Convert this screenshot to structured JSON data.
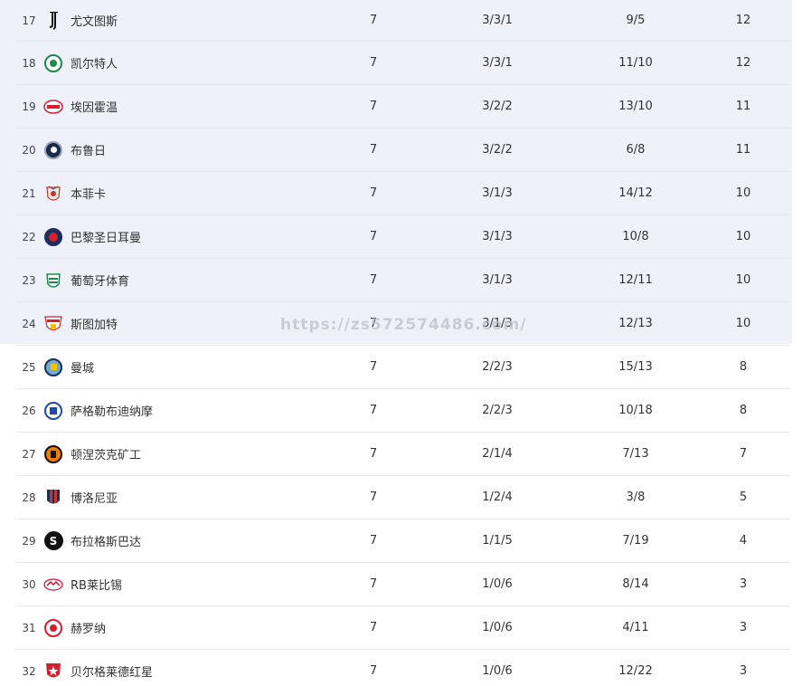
{
  "rows": [
    {
      "rank": "17",
      "team": "尤文图斯",
      "logo": "juventus-logo-icon",
      "played": "7",
      "wdl": "3/3/1",
      "goals": "9/5",
      "points": "12"
    },
    {
      "rank": "18",
      "team": "凯尔特人",
      "logo": "celtic-logo-icon",
      "played": "7",
      "wdl": "3/3/1",
      "goals": "11/10",
      "points": "12"
    },
    {
      "rank": "19",
      "team": "埃因霍温",
      "logo": "psv-logo-icon",
      "played": "7",
      "wdl": "3/2/2",
      "goals": "13/10",
      "points": "11"
    },
    {
      "rank": "20",
      "team": "布鲁日",
      "logo": "club-brugge-logo-icon",
      "played": "7",
      "wdl": "3/2/2",
      "goals": "6/8",
      "points": "11"
    },
    {
      "rank": "21",
      "team": "本菲卡",
      "logo": "benfica-logo-icon",
      "played": "7",
      "wdl": "3/1/3",
      "goals": "14/12",
      "points": "10"
    },
    {
      "rank": "22",
      "team": "巴黎圣日耳曼",
      "logo": "psg-logo-icon",
      "played": "7",
      "wdl": "3/1/3",
      "goals": "10/8",
      "points": "10"
    },
    {
      "rank": "23",
      "team": "葡萄牙体育",
      "logo": "sporting-logo-icon",
      "played": "7",
      "wdl": "3/1/3",
      "goals": "12/11",
      "points": "10"
    },
    {
      "rank": "24",
      "team": "斯图加特",
      "logo": "stuttgart-logo-icon",
      "played": "7",
      "wdl": "3/1/3",
      "goals": "12/13",
      "points": "10"
    },
    {
      "rank": "25",
      "team": "曼城",
      "logo": "man-city-logo-icon",
      "played": "7",
      "wdl": "2/2/3",
      "goals": "15/13",
      "points": "8"
    },
    {
      "rank": "26",
      "team": "萨格勒布迪纳摩",
      "logo": "dinamo-zagreb-logo-icon",
      "played": "7",
      "wdl": "2/2/3",
      "goals": "10/18",
      "points": "8"
    },
    {
      "rank": "27",
      "team": "顿涅茨克矿工",
      "logo": "shakhtar-logo-icon",
      "played": "7",
      "wdl": "2/1/4",
      "goals": "7/13",
      "points": "7"
    },
    {
      "rank": "28",
      "team": "博洛尼亚",
      "logo": "bologna-logo-icon",
      "played": "7",
      "wdl": "1/2/4",
      "goals": "3/8",
      "points": "5"
    },
    {
      "rank": "29",
      "team": "布拉格斯巴达",
      "logo": "sparta-prague-logo-icon",
      "played": "7",
      "wdl": "1/1/5",
      "goals": "7/19",
      "points": "4"
    },
    {
      "rank": "30",
      "team": "RB莱比锡",
      "logo": "rb-leipzig-logo-icon",
      "played": "7",
      "wdl": "1/0/6",
      "goals": "8/14",
      "points": "3"
    },
    {
      "rank": "31",
      "team": "赫罗纳",
      "logo": "girona-logo-icon",
      "played": "7",
      "wdl": "1/0/6",
      "goals": "4/11",
      "points": "3"
    },
    {
      "rank": "32",
      "team": "贝尔格莱德红星",
      "logo": "red-star-logo-icon",
      "played": "7",
      "wdl": "1/0/6",
      "goals": "12/22",
      "points": "3"
    }
  ],
  "watermark": "https://zs572574486.com/",
  "colors": {
    "highlight": "#eef1fa",
    "divider": "#e8e8e8"
  }
}
